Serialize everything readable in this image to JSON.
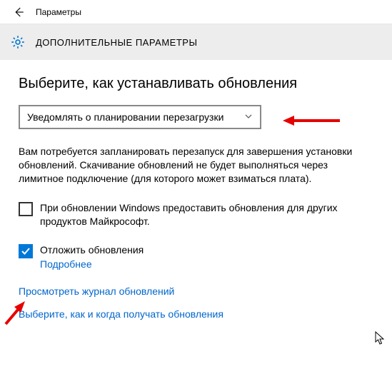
{
  "titlebar": {
    "title": "Параметры"
  },
  "header": {
    "title": "ДОПОЛНИТЕЛЬНЫЕ ПАРАМЕТРЫ"
  },
  "section": {
    "heading": "Выберите, как устанавливать обновления",
    "dropdown_selected": "Уведомлять о планировании перезагрузки",
    "description": "Вам потребуется запланировать перезапуск для завершения установки обновлений. Скачивание обновлений не будет выполняться через лимитное подключение (для которого может взиматься плата)."
  },
  "checkbox_ms": {
    "label": "При обновлении Windows предоставить обновления для других продуктов Майкрософт.",
    "checked": false
  },
  "checkbox_defer": {
    "label": "Отложить обновления",
    "more": "Подробнее",
    "checked": true
  },
  "links": {
    "history": "Просмотреть журнал обновлений",
    "delivery": "Выберите, как и когда получать обновления"
  }
}
